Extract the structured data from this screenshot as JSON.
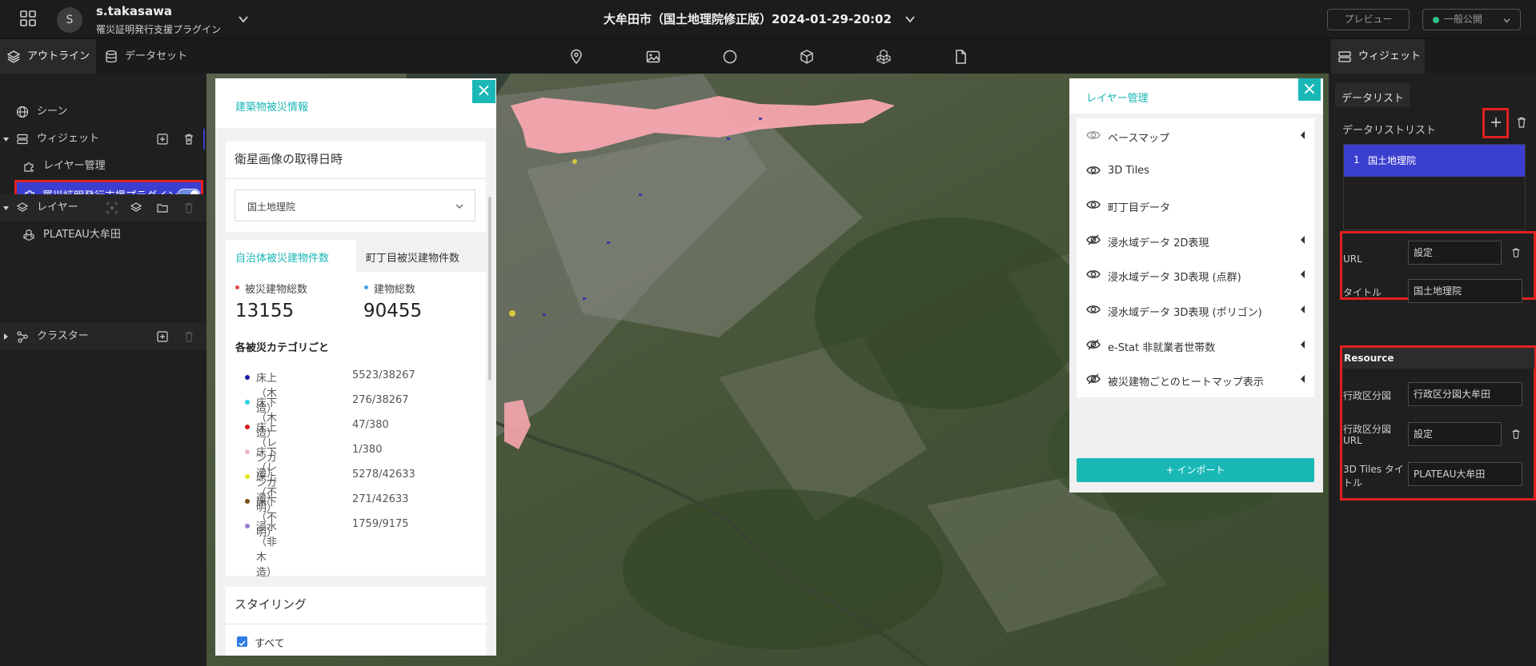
{
  "topbar": {
    "user_initial": "S",
    "user_name": "s.takasawa",
    "project_name": "罹災証明発行支援プラグイン",
    "scene_title": "大牟田市（国土地理院修正版）2024-01-29-20:02",
    "preview_label": "プレビュー",
    "publish_label": "一般公開"
  },
  "subbar": {
    "tab_outline": "アウトライン",
    "tab_dataset": "データセット",
    "tab_widget": "ウィジェット",
    "tools": [
      "pin-icon",
      "image-icon",
      "circle-icon",
      "box-icon",
      "cubes-icon",
      "file-icon"
    ]
  },
  "leftpanel": {
    "scene": "シーン",
    "widget": "ウィジェット",
    "layer_manage": "レイヤー管理",
    "plugin": "罹災証明発行支援プラグイン",
    "layer": "レイヤー",
    "plateau": "PLATEAU大牟田",
    "cluster": "クラスター"
  },
  "infopanel": {
    "title": "建築物被災情報",
    "acq_title": "衛星画像の取得日時",
    "acq_selected": "国土地理院",
    "tab_municipal": "自治体被災建物件数",
    "tab_town": "町丁目被災建物件数",
    "damaged_label": "被災建物総数",
    "damaged_value": "13155",
    "total_label": "建物総数",
    "total_value": "90455",
    "category_heading": "各被災カテゴリごと",
    "categories": [
      {
        "name": "床上（木造）",
        "value": "5523/38267",
        "color": "#1c1ca8"
      },
      {
        "name": "床下（木造）",
        "value": "276/38267",
        "color": "#29d3e0"
      },
      {
        "name": "床上（レンガ造）",
        "value": "47/380",
        "color": "#d11a1a"
      },
      {
        "name": "床下（レンガ造）",
        "value": "1/380",
        "color": "#f1b6cf"
      },
      {
        "name": "床上（不明）",
        "value": "5278/42633",
        "color": "#e5e51c"
      },
      {
        "name": "床下（不明）",
        "value": "271/42633",
        "color": "#7a4a16"
      },
      {
        "name": "浸水（非木造）",
        "value": "1759/9175",
        "color": "#9a7ad8"
      }
    ],
    "styling_title": "スタイリング",
    "styling_all": "すべて"
  },
  "layerpanel": {
    "title": "レイヤー管理",
    "items": [
      {
        "label": "ベースマップ",
        "eye": "visible-dim",
        "arrow": true
      },
      {
        "label": "3D Tiles",
        "eye": "visible",
        "arrow": false
      },
      {
        "label": "町丁目データ",
        "eye": "visible",
        "arrow": false
      },
      {
        "label": "浸水域データ 2D表現",
        "eye": "hidden",
        "arrow": true
      },
      {
        "label": "浸水域データ 3D表現 (点群)",
        "eye": "visible",
        "arrow": true
      },
      {
        "label": "浸水域データ 3D表現 (ポリゴン)",
        "eye": "visible",
        "arrow": true
      },
      {
        "label": "e-Stat 非就業者世帯数",
        "eye": "hidden",
        "arrow": true
      },
      {
        "label": "被災建物ごとのヒートマップ表示",
        "eye": "hidden",
        "arrow": true
      }
    ],
    "import_label": "+ インポート"
  },
  "rightpanel": {
    "datalist_tab": "データリスト",
    "datalist_header": "データリストリスト",
    "datalist_item_index": "1",
    "datalist_item_label": "国土地理院",
    "url_label": "URL",
    "url_value": "設定",
    "title_label": "タイトル",
    "title_value": "国土地理院",
    "resource_heading": "Resource",
    "admin_map_label": "行政区分図",
    "admin_map_value": "行政区分図大牟田",
    "admin_url_label_1": "行政区分図",
    "admin_url_label_2": "URL",
    "admin_url_value": "設定",
    "tiles_title_label_1": "3D Tiles タイ",
    "tiles_title_label_2": "トル",
    "tiles_title_value": "PLATEAU大牟田"
  }
}
